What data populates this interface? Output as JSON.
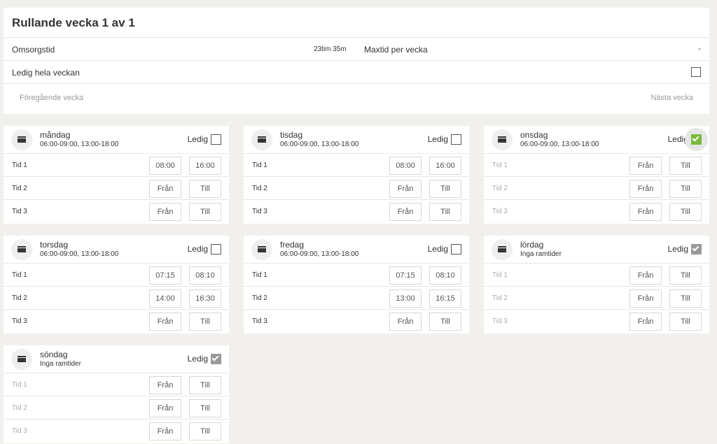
{
  "header": {
    "title": "Rullande vecka 1 av 1",
    "care_label": "Omsorgstid",
    "care_value": "23tim 35m",
    "max_label": "Maxtid per vecka",
    "max_value": "-",
    "free_week_label": "Ledig hela veckan",
    "prev_label": "Föregående vecka",
    "next_label": "Nästa vecka"
  },
  "ledig_label": "Ledig",
  "days": [
    {
      "name": "måndag",
      "sub": "06:00-09:00, 13:00-18:00",
      "ledig": "unchecked",
      "rows": [
        {
          "label": "Tid 1",
          "from": "08:00",
          "to": "16:00"
        },
        {
          "label": "Tid 2",
          "from": "Från",
          "to": "Till"
        },
        {
          "label": "Tid 3",
          "from": "Från",
          "to": "Till"
        }
      ]
    },
    {
      "name": "tisdag",
      "sub": "06:00-09:00, 13:00-18:00",
      "ledig": "unchecked",
      "rows": [
        {
          "label": "Tid 1",
          "from": "08:00",
          "to": "16:00"
        },
        {
          "label": "Tid 2",
          "from": "Från",
          "to": "Till"
        },
        {
          "label": "Tid 3",
          "from": "Från",
          "to": "Till"
        }
      ]
    },
    {
      "name": "onsdag",
      "sub": "06:00-09:00, 13:00-18:00",
      "ledig": "checked-active",
      "rows": [
        {
          "label": "Tid 1",
          "from": "Från",
          "to": "Till"
        },
        {
          "label": "Tid 2",
          "from": "Från",
          "to": "Till"
        },
        {
          "label": "Tid 3",
          "from": "Från",
          "to": "Till"
        }
      ]
    },
    {
      "name": "torsdag",
      "sub": "06:00-09:00, 13:00-18:00",
      "ledig": "unchecked",
      "rows": [
        {
          "label": "Tid 1",
          "from": "07:15",
          "to": "08:10"
        },
        {
          "label": "Tid 2",
          "from": "14:00",
          "to": "16:30"
        },
        {
          "label": "Tid 3",
          "from": "Från",
          "to": "Till"
        }
      ]
    },
    {
      "name": "fredag",
      "sub": "06:00-09:00, 13:00-18:00",
      "ledig": "unchecked",
      "rows": [
        {
          "label": "Tid 1",
          "from": "07:15",
          "to": "08:10"
        },
        {
          "label": "Tid 2",
          "from": "13:00",
          "to": "16:15"
        },
        {
          "label": "Tid 3",
          "from": "Från",
          "to": "Till"
        }
      ]
    },
    {
      "name": "lördag",
      "sub": "Inga ramtider",
      "ledig": "checked",
      "rows": [
        {
          "label": "Tid 1",
          "from": "Från",
          "to": "Till"
        },
        {
          "label": "Tid 2",
          "from": "Från",
          "to": "Till"
        },
        {
          "label": "Tid 3",
          "from": "Från",
          "to": "Till"
        }
      ]
    },
    {
      "name": "söndag",
      "sub": "Inga ramtider",
      "ledig": "checked",
      "rows": [
        {
          "label": "Tid 1",
          "from": "Från",
          "to": "Till"
        },
        {
          "label": "Tid 2",
          "from": "Från",
          "to": "Till"
        },
        {
          "label": "Tid 3",
          "from": "Från",
          "to": "Till"
        }
      ]
    }
  ],
  "colors": {
    "accent": "#7ab93a",
    "background": "#f1f0ec",
    "checked_grey": "#999999"
  }
}
